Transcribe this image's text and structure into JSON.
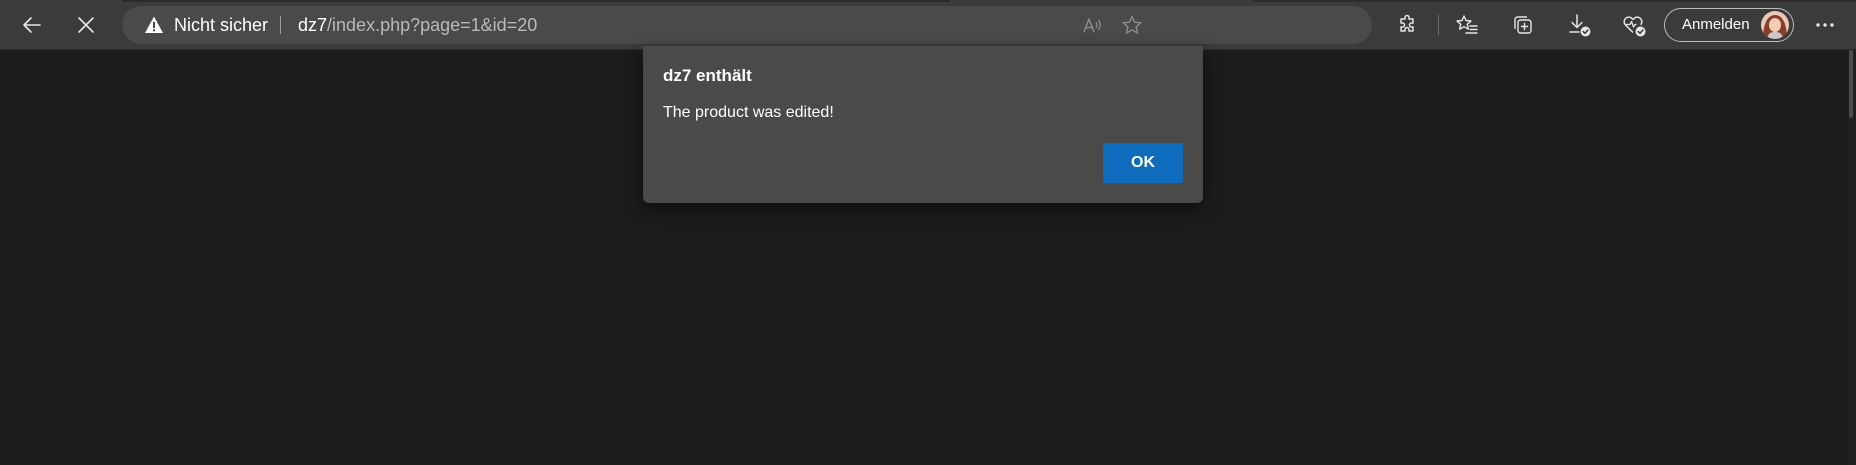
{
  "browser": {
    "security_label": "Nicht sicher",
    "url_host": "dz7",
    "url_path": "/index.php?page=1&id=20",
    "signin_label": "Anmelden"
  },
  "toolbar_icons": {
    "back": "back-arrow-icon",
    "stop": "close-icon",
    "read_aloud": "read-aloud-icon",
    "favorite": "star-icon",
    "extensions": "puzzle-icon",
    "favorites": "favorites-list-icon",
    "collections": "collections-icon",
    "downloads": "download-icon",
    "browser_essentials": "heart-pulse-icon",
    "more": "more-icon"
  },
  "dialog": {
    "title": "dz7 enthält",
    "message": "The product was edited!",
    "ok_label": "OK"
  },
  "colors": {
    "page_background": "#1b1c1e",
    "toolbar": "#3b3b3b",
    "dialog": "#4a4a4a",
    "accent": "#0f6cbd"
  }
}
